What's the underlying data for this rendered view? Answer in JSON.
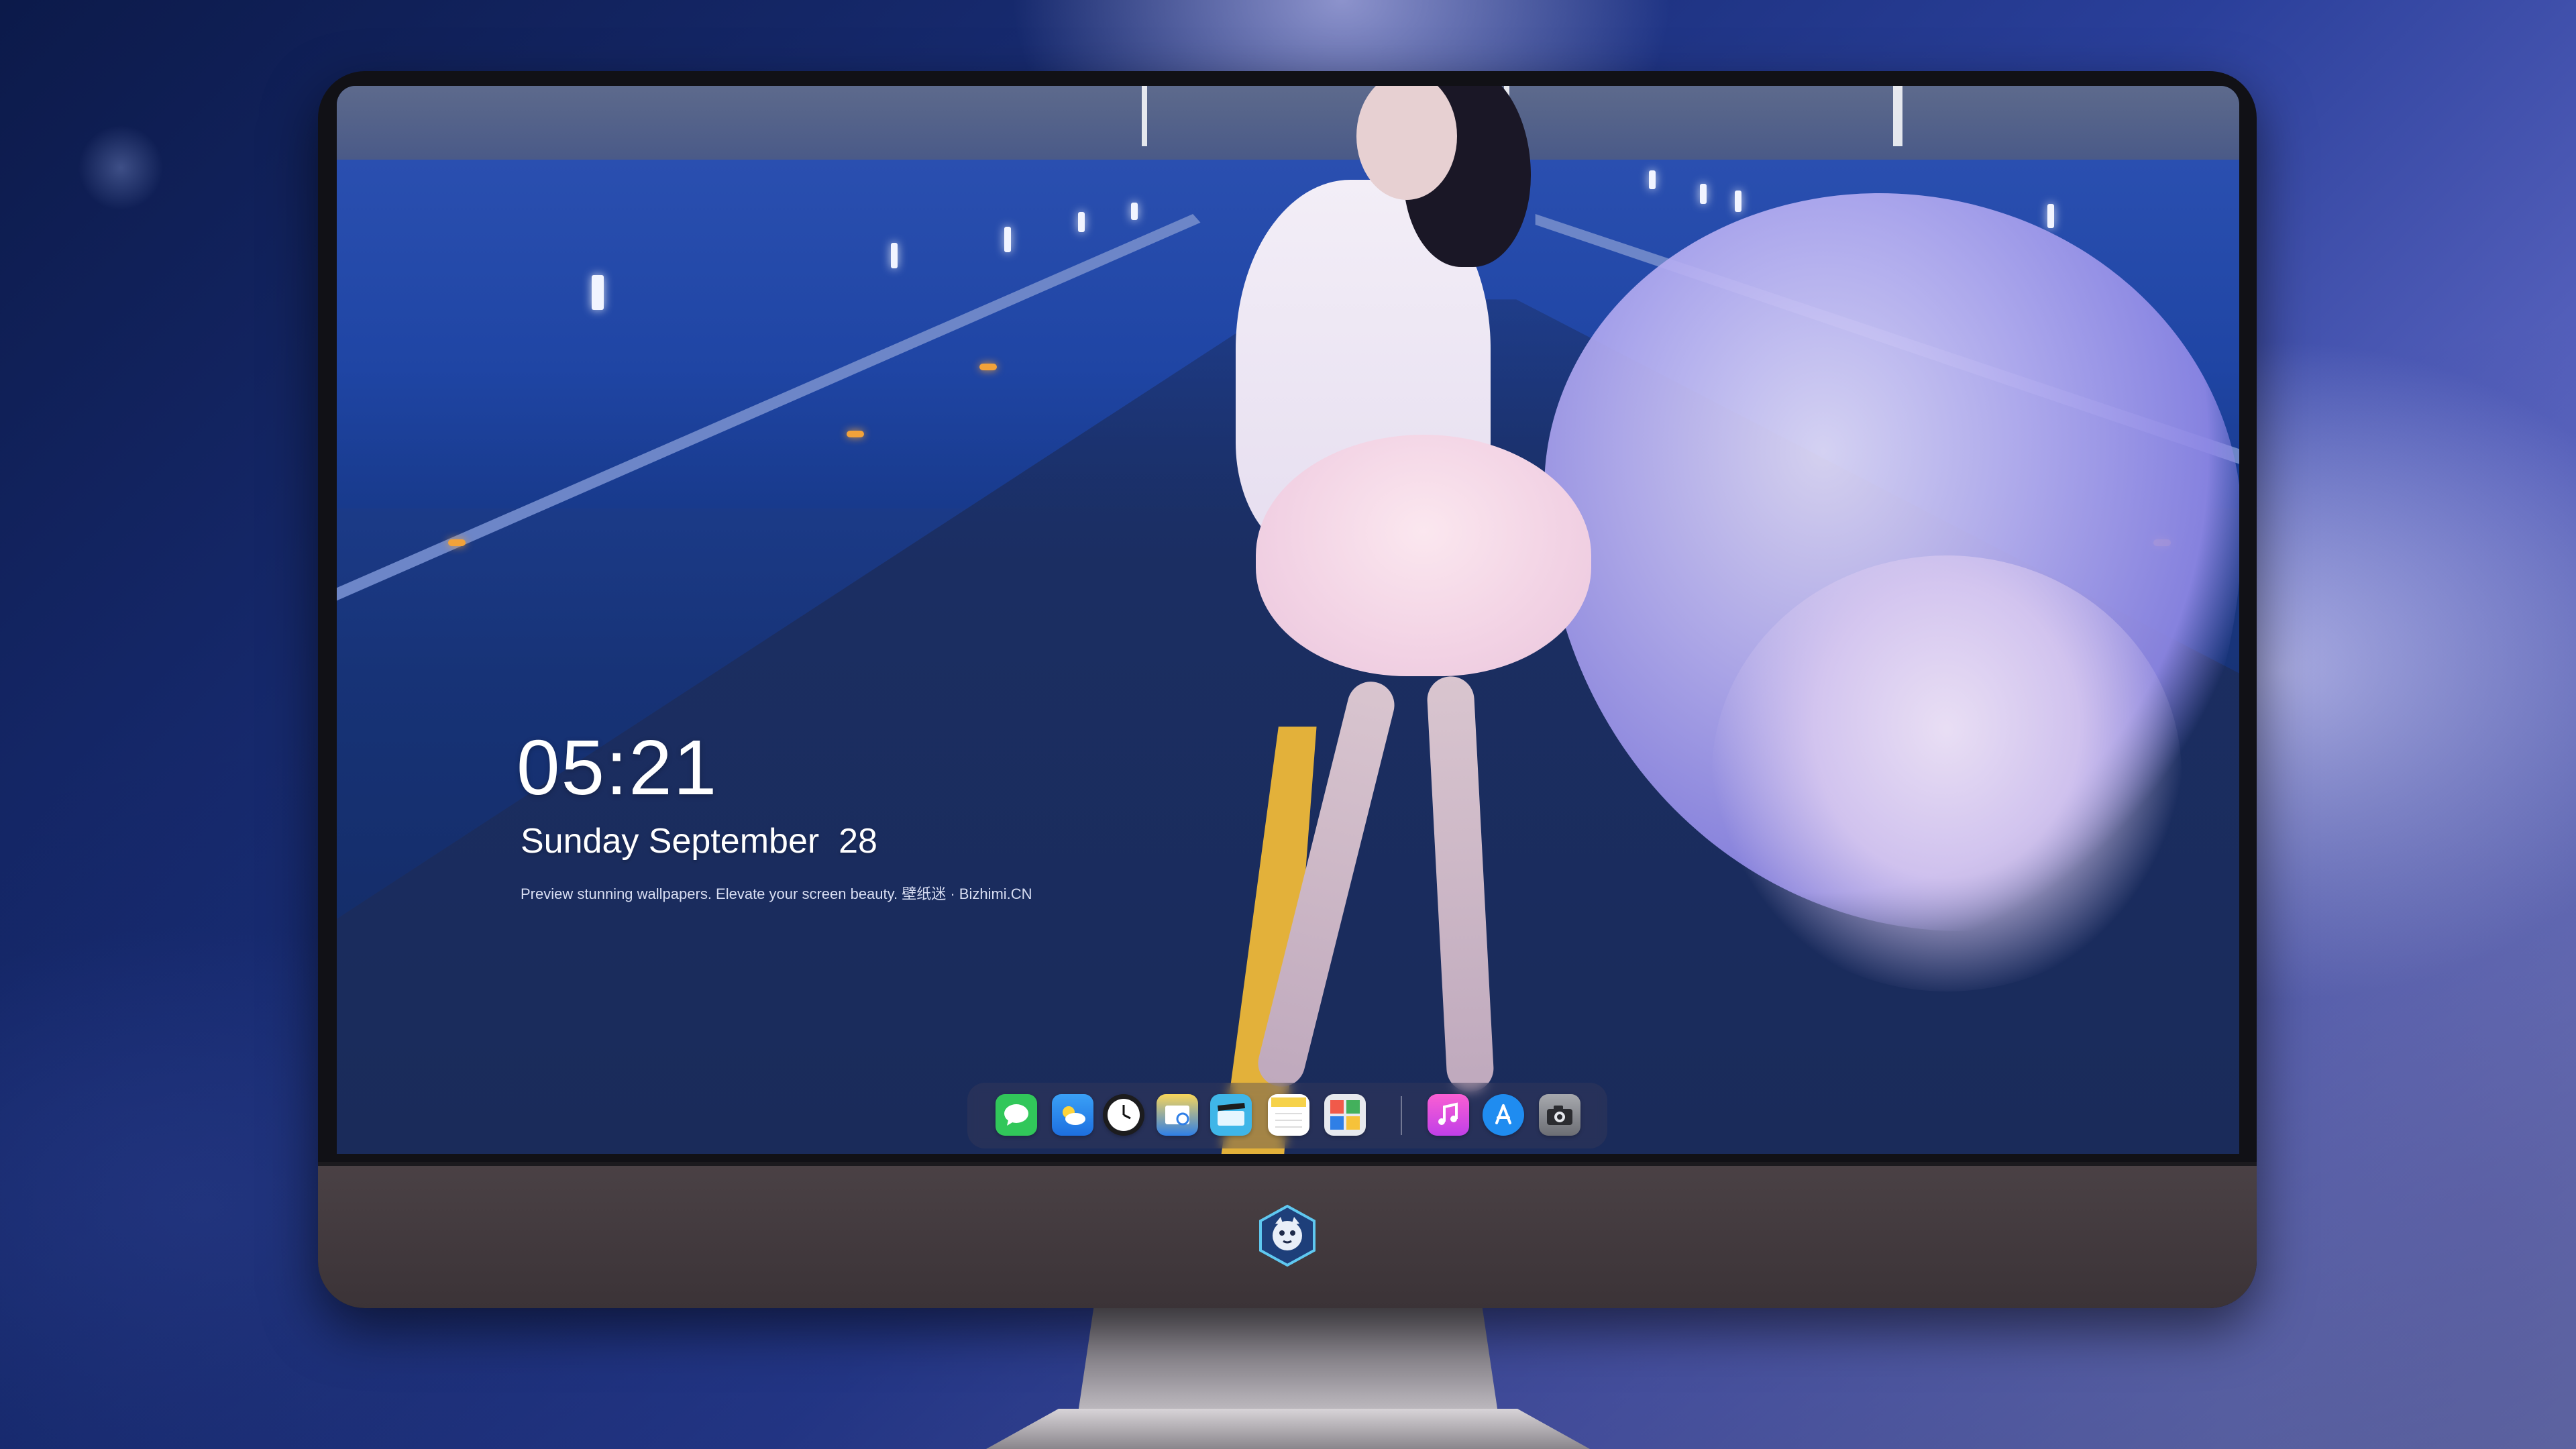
{
  "lock_screen": {
    "time": "05:21",
    "date": "Sunday September  28",
    "tagline": "Preview stunning wallpapers. Elevate your screen beauty. 壁纸迷 · Bizhimi.CN"
  },
  "dock": {
    "apps": [
      {
        "name": "messages-icon",
        "color": "#31c75a"
      },
      {
        "name": "weather-icon",
        "color": "#2f8df2"
      },
      {
        "name": "clock-icon",
        "color": "#1c1c1e"
      },
      {
        "name": "preview-icon",
        "color": "#f4c542"
      },
      {
        "name": "clips-icon",
        "color": "#3fb6e8"
      },
      {
        "name": "notes-icon",
        "color": "#f6d24a"
      },
      {
        "name": "photo-booth-icon",
        "color": "#e7e9ee"
      },
      {
        "name": "music-icon",
        "color": "#f04fbf"
      },
      {
        "name": "app-store-icon",
        "color": "#1f8cf0"
      },
      {
        "name": "camera-icon",
        "color": "#8a8c92"
      }
    ]
  },
  "colors": {
    "monitor_bezel": "#111116",
    "monitor_chin": "#3b3337",
    "dock_background": "rgba(60,60,90,0.38)",
    "text": "#ffffff"
  }
}
